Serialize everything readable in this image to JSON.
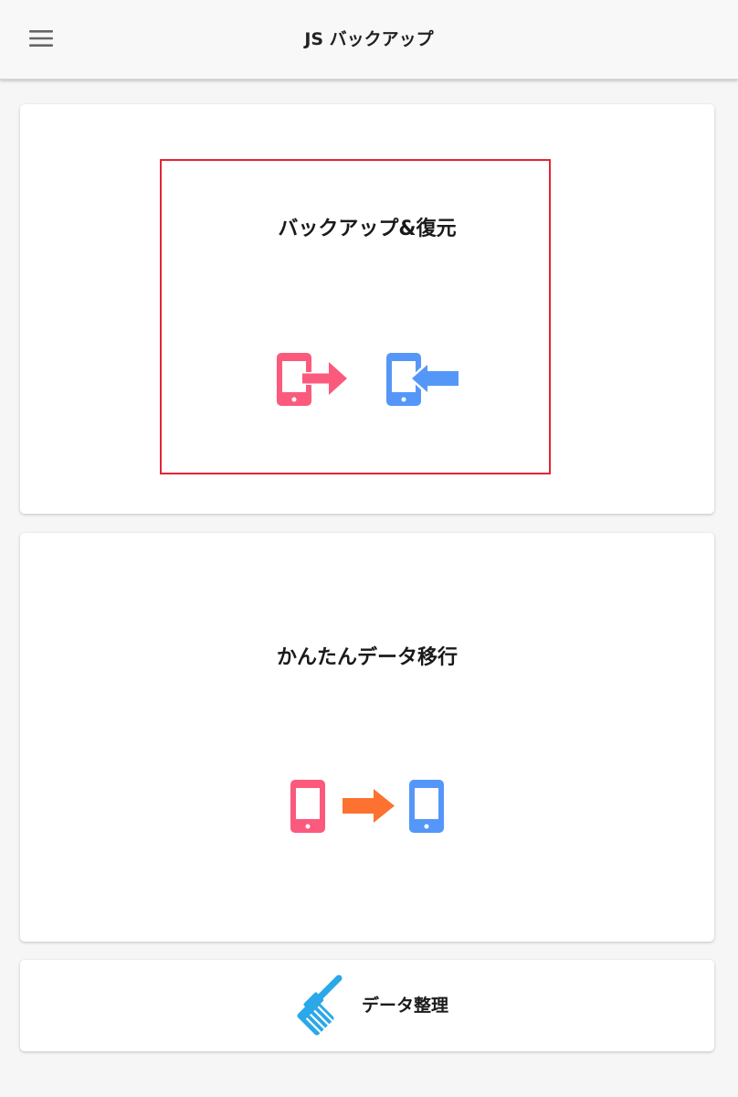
{
  "header": {
    "title": "JS バックアップ",
    "menu_icon": "hamburger-menu-icon"
  },
  "cards": [
    {
      "id": "backup-restore",
      "title": "バックアップ&復元",
      "icons": [
        "phone-export-icon",
        "phone-import-icon"
      ],
      "highlighted": true,
      "highlight_color": "#e52534"
    },
    {
      "id": "easy-migration",
      "title": "かんたんデータ移行",
      "icons": [
        "phone-icon",
        "arrow-right-icon",
        "phone-icon"
      ]
    },
    {
      "id": "data-cleanup",
      "title": "データ整理",
      "icons": [
        "broom-icon"
      ]
    }
  ],
  "colors": {
    "pink": "#fb5a7d",
    "blue": "#5597f8",
    "orange": "#fd7231",
    "light_blue": "#2aa8e8",
    "highlight": "#e52534"
  }
}
